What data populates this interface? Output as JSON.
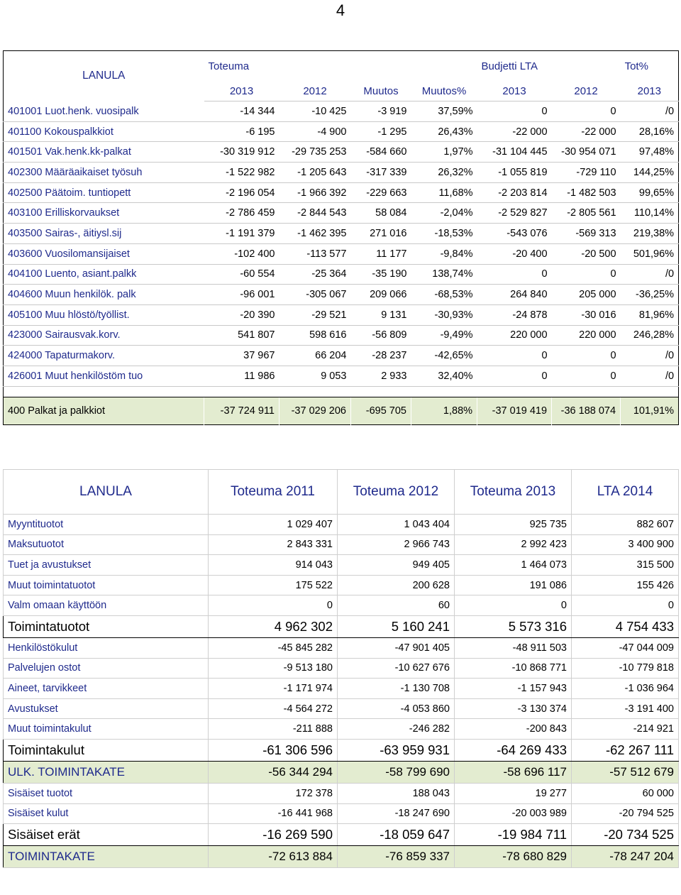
{
  "page_number": "4",
  "table1": {
    "corner_label": "LANULA",
    "groups": {
      "toteuma": "Toteuma",
      "budjetti": "Budjetti LTA",
      "tot_pct": "Tot%"
    },
    "columns": [
      "2013",
      "2012",
      "Muutos",
      "Muutos%",
      "2013",
      "2012",
      "2013"
    ],
    "rows": [
      {
        "account": "401001 Luot.henk. vuosipalk",
        "values": [
          "-14 344",
          "-10 425",
          "-3 919",
          "37,59%",
          "0",
          "0",
          "/0"
        ]
      },
      {
        "account": "401100 Kokouspalkkiot",
        "values": [
          "-6 195",
          "-4 900",
          "-1 295",
          "26,43%",
          "-22 000",
          "-22 000",
          "28,16%"
        ]
      },
      {
        "account": "401501 Vak.henk.kk-palkat",
        "values": [
          "-30 319 912",
          "-29 735 253",
          "-584 660",
          "1,97%",
          "-31 104 445",
          "-30 954 071",
          "97,48%"
        ]
      },
      {
        "account": "402300 Määräaikaiset työsuh",
        "values": [
          "-1 522 982",
          "-1 205 643",
          "-317 339",
          "26,32%",
          "-1 055 819",
          "-729 110",
          "144,25%"
        ]
      },
      {
        "account": "402500 Päätoim. tuntiopett",
        "values": [
          "-2 196 054",
          "-1 966 392",
          "-229 663",
          "11,68%",
          "-2 203 814",
          "-1 482 503",
          "99,65%"
        ]
      },
      {
        "account": "403100 Erilliskorvaukset",
        "values": [
          "-2 786 459",
          "-2 844 543",
          "58 084",
          "-2,04%",
          "-2 529 827",
          "-2 805 561",
          "110,14%"
        ]
      },
      {
        "account": "403500 Sairas-, äitiysl.sij",
        "values": [
          "-1 191 379",
          "-1 462 395",
          "271 016",
          "-18,53%",
          "-543 076",
          "-569 313",
          "219,38%"
        ]
      },
      {
        "account": "403600 Vuosilomansijaiset",
        "values": [
          "-102 400",
          "-113 577",
          "11 177",
          "-9,84%",
          "-20 400",
          "-20 500",
          "501,96%"
        ]
      },
      {
        "account": "404100 Luento, asiant.palkk",
        "values": [
          "-60 554",
          "-25 364",
          "-35 190",
          "138,74%",
          "0",
          "0",
          "/0"
        ]
      },
      {
        "account": "404600 Muun henkilök. palk",
        "values": [
          "-96 001",
          "-305 067",
          "209 066",
          "-68,53%",
          "264 840",
          "205 000",
          "-36,25%"
        ]
      },
      {
        "account": "405100 Muu hlöstö/työllist.",
        "values": [
          "-20 390",
          "-29 521",
          "9 131",
          "-30,93%",
          "-24 878",
          "-30 016",
          "81,96%"
        ]
      },
      {
        "account": "423000 Sairausvak.korv.",
        "values": [
          "541 807",
          "598 616",
          "-56 809",
          "-9,49%",
          "220 000",
          "220 000",
          "246,28%"
        ]
      },
      {
        "account": "424000 Tapaturmakorv.",
        "values": [
          "37 967",
          "66 204",
          "-28 237",
          "-42,65%",
          "0",
          "0",
          "/0"
        ]
      },
      {
        "account": "426001 Muut henkilöstöm tuo",
        "values": [
          "11 986",
          "9 053",
          "2 933",
          "32,40%",
          "0",
          "0",
          "/0"
        ]
      }
    ],
    "total": {
      "account": "400 Palkat ja palkkiot",
      "values": [
        "-37 724 911",
        "-37 029 206",
        "-695 705",
        "1,88%",
        "-37 019 419",
        "-36 188 074",
        "101,91%"
      ]
    }
  },
  "table2": {
    "headers": [
      "LANULA",
      "Toteuma 2011",
      "Toteuma 2012",
      "Toteuma 2013",
      "LTA 2014"
    ],
    "rows": [
      {
        "type": "item",
        "label": "Myyntituotot",
        "values": [
          "1 029 407",
          "1 043 404",
          "925 735",
          "882 607"
        ]
      },
      {
        "type": "item",
        "label": "Maksutuotot",
        "values": [
          "2 843 331",
          "2 966 743",
          "2 992 423",
          "3 400 900"
        ]
      },
      {
        "type": "item",
        "label": "Tuet ja avustukset",
        "values": [
          "914 043",
          "949 405",
          "1 464 073",
          "315 500"
        ]
      },
      {
        "type": "item",
        "label": "Muut toimintatuotot",
        "values": [
          "175 522",
          "200 628",
          "191 086",
          "155 426"
        ]
      },
      {
        "type": "item",
        "label": "Valm omaan käyttöön",
        "values": [
          "0",
          "60",
          "0",
          "0"
        ]
      },
      {
        "type": "sub",
        "label": "Toimintatuotot",
        "values": [
          "4 962 302",
          "5 160 241",
          "5 573 316",
          "4 754 433"
        ]
      },
      {
        "type": "item",
        "label": "Henkilöstökulut",
        "values": [
          "-45 845 282",
          "-47 901 405",
          "-48 911 503",
          "-47 044 009"
        ]
      },
      {
        "type": "item",
        "label": "Palvelujen ostot",
        "values": [
          "-9 513 180",
          "-10 627 676",
          "-10 868 771",
          "-10 779 818"
        ]
      },
      {
        "type": "item",
        "label": "Aineet, tarvikkeet",
        "values": [
          "-1 171 974",
          "-1 130 708",
          "-1 157 943",
          "-1 036 964"
        ]
      },
      {
        "type": "item",
        "label": "Avustukset",
        "values": [
          "-4 564 272",
          "-4 053 860",
          "-3 130 374",
          "-3 191 400"
        ]
      },
      {
        "type": "item",
        "label": "Muut toimintakulut",
        "values": [
          "-211 888",
          "-246 282",
          "-200 843",
          "-214 921"
        ]
      },
      {
        "type": "sub",
        "label": "Toimintakulut",
        "values": [
          "-61 306 596",
          "-63 959 931",
          "-64 269 433",
          "-62 267 111"
        ]
      },
      {
        "type": "green",
        "label": "ULK. TOIMINTAKATE",
        "values": [
          "-56 344 294",
          "-58 799 690",
          "-58 696 117",
          "-57 512 679"
        ]
      },
      {
        "type": "item",
        "label": "Sisäiset tuotot",
        "values": [
          "172 378",
          "188 043",
          "19 277",
          "60 000"
        ]
      },
      {
        "type": "item",
        "label": "Sisäiset kulut",
        "values": [
          "-16 441 968",
          "-18 247 690",
          "-20 003 989",
          "-20 794 525"
        ]
      },
      {
        "type": "sub",
        "label": "Sisäiset erät",
        "values": [
          "-16 269 590",
          "-18 059 647",
          "-19 984 711",
          "-20 734 525"
        ]
      },
      {
        "type": "green",
        "label": "TOIMINTAKATE",
        "values": [
          "-72 613 884",
          "-76 859 337",
          "-78 680 829",
          "-78 247 204"
        ]
      }
    ]
  }
}
